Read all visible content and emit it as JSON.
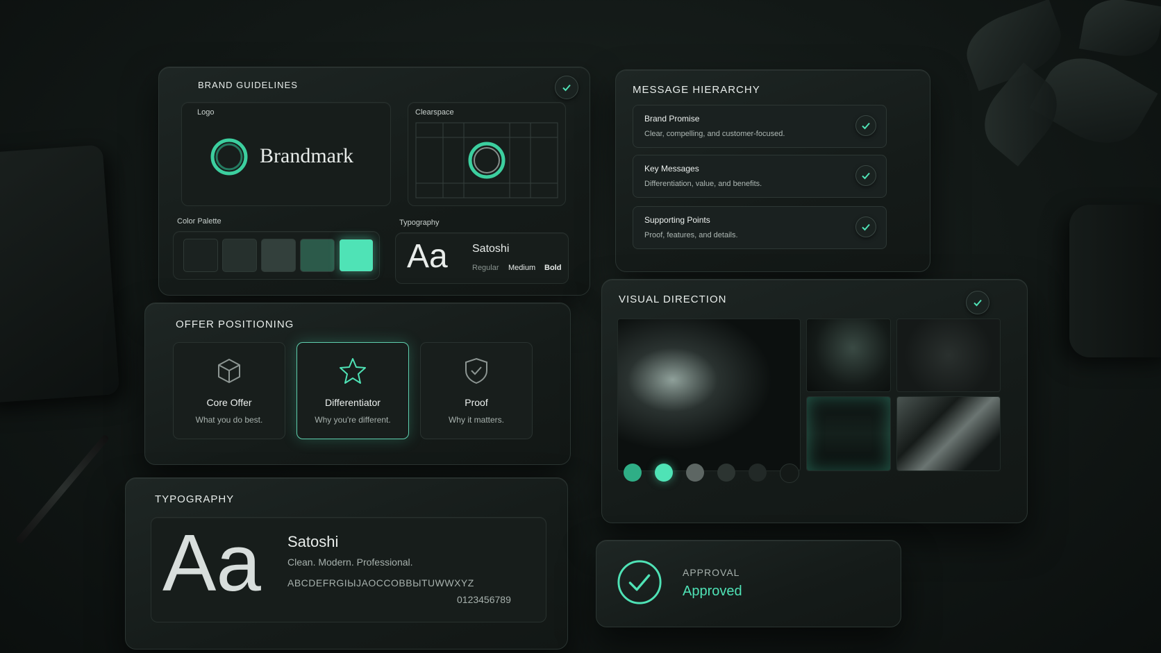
{
  "brand_guidelines": {
    "title": "BRAND GUIDELINES",
    "logo_label": "Logo",
    "logo_wordmark": "Brandmark",
    "clearspace_label": "Clearspace",
    "color_palette_label": "Color Palette",
    "palette": [
      "#1b2220",
      "#26302d",
      "#33403c",
      "#2c5a4a",
      "#4fe3b6"
    ],
    "typography_label": "Typography",
    "type_sample": "Aa",
    "font_name": "Satoshi",
    "weights": [
      "Regular",
      "Medium",
      "Bold"
    ]
  },
  "message_hierarchy": {
    "title": "MESSAGE HIERARCHY",
    "items": [
      {
        "title": "Brand Promise",
        "desc": "Clear, compelling, and customer-focused."
      },
      {
        "title": "Key Messages",
        "desc": "Differentiation, value, and benefits."
      },
      {
        "title": "Supporting Points",
        "desc": "Proof, features, and details."
      }
    ]
  },
  "offer_positioning": {
    "title": "OFFER POSITIONING",
    "cards": [
      {
        "icon": "cube-icon",
        "name": "Core Offer",
        "desc": "What you do best."
      },
      {
        "icon": "star-icon",
        "name": "Differentiator",
        "desc": "Why you're different."
      },
      {
        "icon": "shield-check-icon",
        "name": "Proof",
        "desc": "Why it matters."
      }
    ]
  },
  "visual_direction": {
    "title": "VISUAL DIRECTION",
    "swatches": [
      "#2fae86",
      "#4fe3b6",
      "#5d6663",
      "#2c3431",
      "#222927",
      "#141917"
    ]
  },
  "typography": {
    "title": "TYPOGRAPHY",
    "sample": "Aa",
    "font_name": "Satoshi",
    "tagline": "Clean. Modern. Professional.",
    "alphabet": "ABCDEFRGIЫJAOCCOBBЫTUWWXYZ",
    "digits": "0123456789"
  },
  "approval": {
    "label": "APPROVAL",
    "status": "Approved"
  },
  "colors": {
    "accent": "#4fe3b6",
    "background": "#121816"
  }
}
